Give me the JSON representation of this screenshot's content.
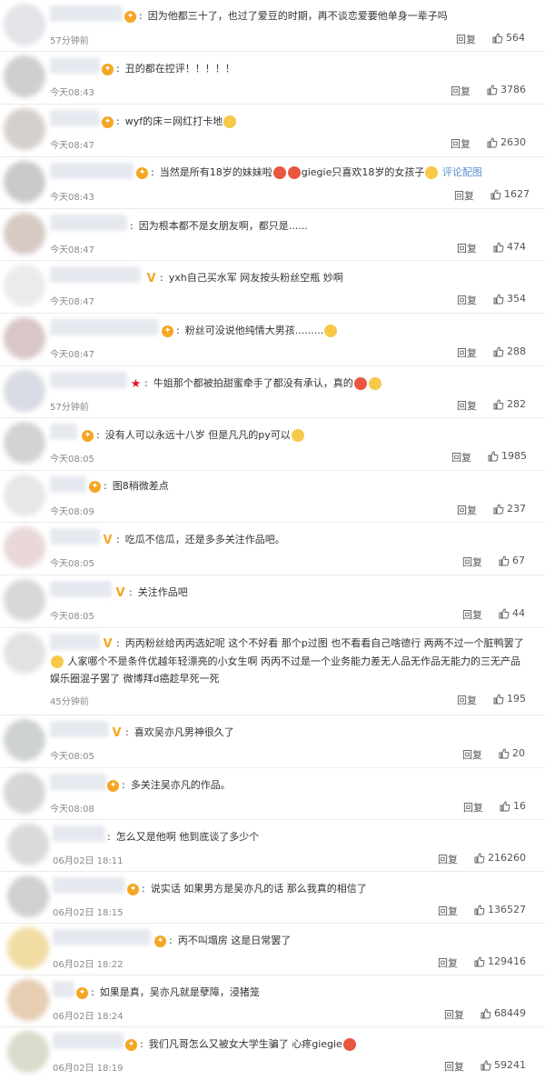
{
  "comments": [
    {
      "text": "因为他都三十了，也过了爱豆的时期，再不谈恋爱要他单身一辈子吗",
      "time": "57分钟前",
      "reply": "回复",
      "likes": "564"
    },
    {
      "text": "丑的都在控评！！！！！",
      "time": "今天08:43",
      "reply": "回复",
      "likes": "3786"
    },
    {
      "text": "wyf的床＝网红打卡地",
      "time": "今天08:47",
      "reply": "回复",
      "likes": "2630"
    },
    {
      "text_a": "当然是所有18岁的妹妹啦",
      "text_b": "giegie只喜欢18岁的女孩子",
      "link": "评论配图",
      "time": "今天08:43",
      "reply": "回复",
      "likes": "1627"
    },
    {
      "text": "因为根本都不是女朋友啊，都只是......",
      "time": "今天08:47",
      "reply": "回复",
      "likes": "474"
    },
    {
      "text": "yxh自己买水军 网友按头粉丝空瓶 妙啊",
      "time": "今天08:47",
      "reply": "回复",
      "likes": "354"
    },
    {
      "text": "粉丝可没说他纯情大男孩.........",
      "time": "今天08:47",
      "reply": "回复",
      "likes": "288"
    },
    {
      "text": "牛姐那个都被拍甜蜜牵手了都没有承认，真的",
      "time": "57分钟前",
      "reply": "回复",
      "likes": "282"
    },
    {
      "text": "没有人可以永远十八岁 但是凡凡的py可以",
      "time": "今天08:05",
      "reply": "回复",
      "likes": "1985"
    },
    {
      "text": "图8稍微差点",
      "time": "今天08:09",
      "reply": "回复",
      "likes": "237"
    },
    {
      "text": "吃瓜不信瓜，还是多多关注作品吧。",
      "time": "今天08:05",
      "reply": "回复",
      "likes": "67"
    },
    {
      "text": "关注作品吧",
      "time": "今天08:05",
      "reply": "回复",
      "likes": "44"
    },
    {
      "line1": "丙丙粉丝给丙丙选妃呢 这个不好看 那个p过图 也不看看自己啥德行 两两不过一个脏鸭罢了",
      "line2": "人家哪个不是条件优越年轻漂亮的小女生啊 丙丙不过是一个业务能力差无人品无作品无能力的三无产品",
      "line3": "娱乐圈混子罢了 微博拜d癌趁早死一死",
      "time": "45分钟前",
      "reply": "回复",
      "likes": "195"
    },
    {
      "text": "喜欢吴亦凡男神很久了",
      "time": "今天08:05",
      "reply": "回复",
      "likes": "20"
    },
    {
      "text": "多关注吴亦凡的作品。",
      "time": "今天08:08",
      "reply": "回复",
      "likes": "16"
    },
    {
      "text": "怎么又是他啊 他到底谈了多少个",
      "time": "06月02日 18:11",
      "reply": "回复",
      "likes": "216260"
    },
    {
      "text": "说实话 如果男方是吴亦凡的话 那么我真的相信了",
      "time": "06月02日 18:15",
      "reply": "回复",
      "likes": "136527"
    },
    {
      "text": "丙不叫塌房 这是日常罢了",
      "time": "06月02日 18:22",
      "reply": "回复",
      "likes": "129416"
    },
    {
      "text": "如果是真，吴亦凡就是孽障，浸猪笼",
      "time": "06月02日 18:24",
      "reply": "回复",
      "likes": "68449"
    },
    {
      "text": "我们凡哥怎么又被女大学生骗了 心疼giegie",
      "time": "06月02日 18:19",
      "reply": "回复",
      "likes": "59241"
    }
  ],
  "colors": {
    "accent": "#f5a623",
    "link": "#5a8ecf",
    "muted": "#8a8a8a"
  }
}
